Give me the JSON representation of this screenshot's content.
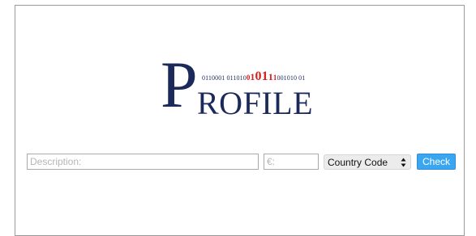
{
  "logo": {
    "letter_p": "P",
    "letters_rest": "ROFILE",
    "binary_prefix": "0110001 011010",
    "binary_red_1": "0",
    "binary_red_2": "1",
    "binary_red_3": "0",
    "binary_red_4": "1",
    "binary_red_5": "1",
    "binary_red_6": "1",
    "binary_suffix": "001010 01",
    "accent_color": "#d42020",
    "brand_color": "#1b2a5a"
  },
  "form": {
    "description_placeholder": "Description:",
    "description_value": "",
    "amount_placeholder": "€:",
    "amount_value": "",
    "country_selected": "Country Code",
    "check_label": "Check",
    "check_color": "#3aa6f0"
  }
}
